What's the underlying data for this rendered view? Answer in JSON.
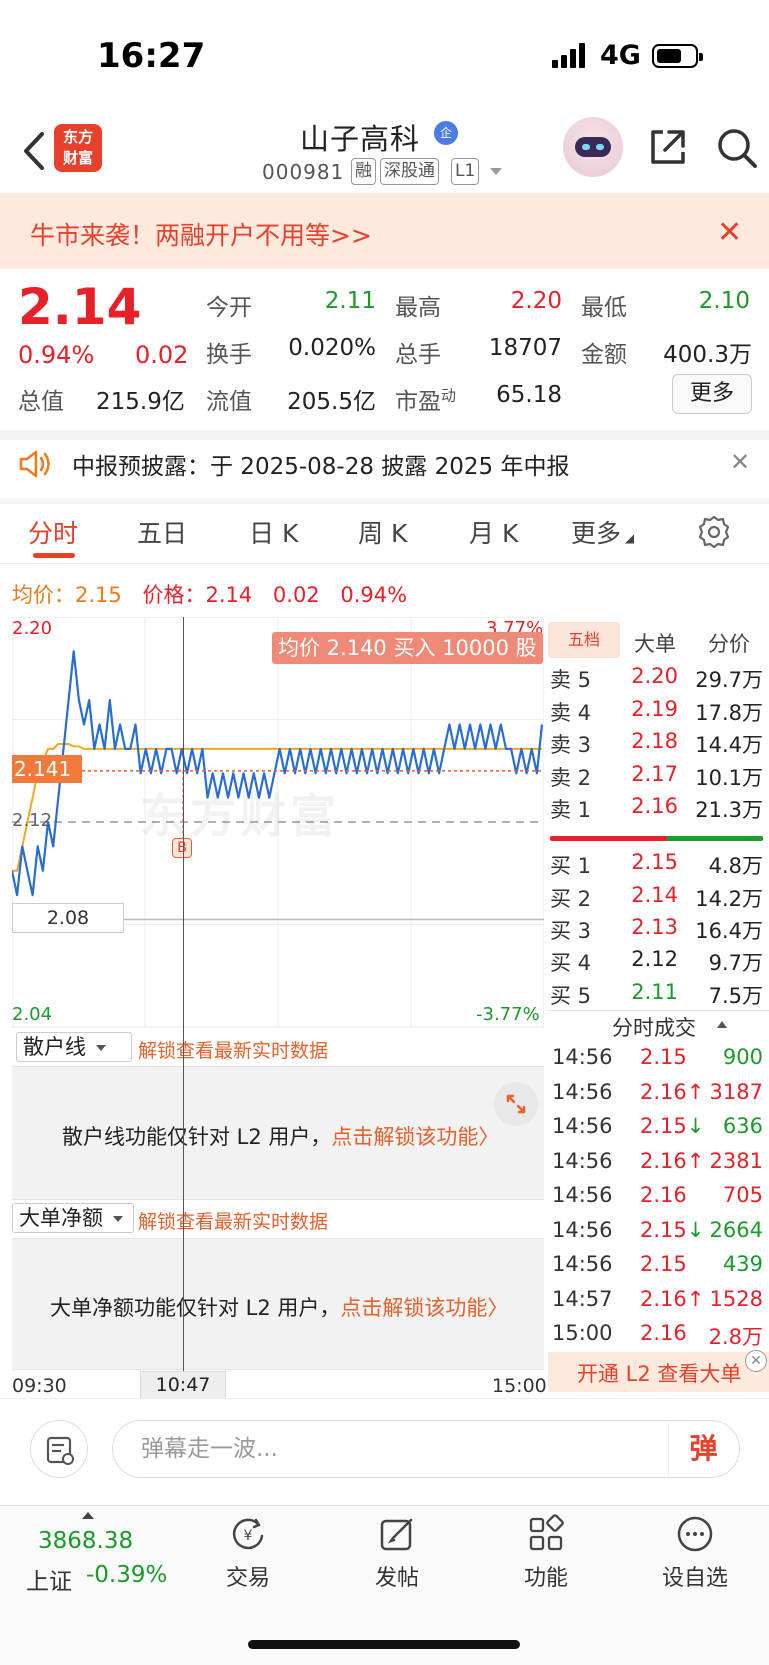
{
  "status_bar": {
    "time": "16:27",
    "network": "4G"
  },
  "header": {
    "logo_text": "东方财富",
    "stock_name": "山子高科",
    "verified_badge": "企",
    "stock_code": "000981",
    "tags": [
      "融",
      "深股通",
      "L1"
    ]
  },
  "promo": {
    "text": "牛市来袭！两融开户不用等>>"
  },
  "quote": {
    "price": "2.14",
    "change_pct": "0.94%",
    "change_amt": "0.02",
    "open_label": "今开",
    "open_value": "2.11",
    "high_label": "最高",
    "high_value": "2.20",
    "low_label": "最低",
    "low_value": "2.10",
    "turnover_label": "换手",
    "turnover_value": "0.020%",
    "volume_label": "总手",
    "volume_value": "18707",
    "amount_label": "金额",
    "amount_value": "400.3万",
    "cap_total_label": "总值",
    "cap_total_value": "215.9亿",
    "cap_float_label": "流值",
    "cap_float_value": "205.5亿",
    "pe_label": "市盈",
    "pe_sup": "动",
    "pe_value": "65.18",
    "more_label": "更多"
  },
  "notice": {
    "text": "中报预披露：于 2025-08-28 披露 2025 年中报"
  },
  "tabs": [
    "分时",
    "五日",
    "日 K",
    "周 K",
    "月 K",
    "更多"
  ],
  "price_line": {
    "avg_label": "均价：",
    "avg_value": "2.15",
    "price_label": "价格：",
    "price_value": "2.14",
    "change_amt": "0.02",
    "change_pct": "0.94%"
  },
  "chart": {
    "y_max": "2.20",
    "y_max_pct": "3.77%",
    "y_mid": "2.12",
    "y_min": "2.04",
    "y_min_pct": "-3.77%",
    "cursor_price": "2.141",
    "low_box": "2.08",
    "tooltip": "均价 2.140 买入 10000 股",
    "trade_marker": "B",
    "watermark": "东方财富",
    "time_start": "09:30",
    "cursor_time": "10:47",
    "time_end": "15:00"
  },
  "chart_data": {
    "type": "line",
    "title": "",
    "ylim": [
      2.04,
      2.2
    ],
    "reference_price": 2.12,
    "series": [
      {
        "values": [
          2.1,
          2.09,
          2.11,
          2.1,
          2.09,
          2.11,
          2.1,
          2.12,
          2.11,
          2.13,
          2.15,
          2.17,
          2.19,
          2.17,
          2.16,
          2.17,
          2.15,
          2.16,
          2.15,
          2.17,
          2.15,
          2.16,
          2.15,
          2.15,
          2.16,
          2.14,
          2.15,
          2.14,
          2.15,
          2.14,
          2.15,
          2.15,
          2.14,
          2.15,
          2.14,
          2.15,
          2.14,
          2.15,
          2.13,
          2.14,
          2.13,
          2.14,
          2.13,
          2.14,
          2.13,
          2.14,
          2.13,
          2.14,
          2.13,
          2.14,
          2.13,
          2.14,
          2.15,
          2.14,
          2.15,
          2.14,
          2.15,
          2.14,
          2.15,
          2.14,
          2.15,
          2.14,
          2.15,
          2.14,
          2.15,
          2.14,
          2.15,
          2.14,
          2.15,
          2.14,
          2.15,
          2.14,
          2.15,
          2.14,
          2.15,
          2.14,
          2.15,
          2.14,
          2.15,
          2.14,
          2.15,
          2.14,
          2.15,
          2.14,
          2.15,
          2.16,
          2.15,
          2.16,
          2.15,
          2.16,
          2.15,
          2.16,
          2.15,
          2.16,
          2.15,
          2.16,
          2.15,
          2.15,
          2.14,
          2.15,
          2.14,
          2.15,
          2.14,
          2.16
        ]
      },
      {
        "values": [
          2.1,
          2.1,
          2.11,
          2.12,
          2.13,
          2.14,
          2.145,
          2.15,
          2.15,
          2.152,
          2.152,
          2.152,
          2.151,
          2.151,
          2.15,
          2.15,
          2.15,
          2.15,
          2.15,
          2.15,
          2.15,
          2.15,
          2.15,
          2.15,
          2.15,
          2.15,
          2.15,
          2.15,
          2.15,
          2.15,
          2.15,
          2.15,
          2.15,
          2.15,
          2.15,
          2.15,
          2.15,
          2.15,
          2.15,
          2.15,
          2.15,
          2.15,
          2.15,
          2.15,
          2.15,
          2.15,
          2.15,
          2.15,
          2.15,
          2.15,
          2.15,
          2.15,
          2.15,
          2.15,
          2.15,
          2.15,
          2.15,
          2.15,
          2.15,
          2.15,
          2.15,
          2.15,
          2.15,
          2.15,
          2.15,
          2.15,
          2.15,
          2.15,
          2.15,
          2.15,
          2.15,
          2.15,
          2.15,
          2.15,
          2.15,
          2.15,
          2.15,
          2.15,
          2.15,
          2.15,
          2.15,
          2.15,
          2.15,
          2.15,
          2.15,
          2.15,
          2.15,
          2.15,
          2.15,
          2.15,
          2.15,
          2.15,
          2.15,
          2.15,
          2.15,
          2.15,
          2.15,
          2.15,
          2.15,
          2.15,
          2.15,
          2.15,
          2.15,
          2.15
        ]
      }
    ],
    "colors": {
      "price": "#2a6dd0",
      "average": "#f5a623"
    }
  },
  "subpanels": [
    {
      "select": "散户线",
      "unlock_link": "解锁查看最新实时数据",
      "locked_msg": "散户线功能仅针对 L2 用户，",
      "locked_link": "点击解锁该功能〉"
    },
    {
      "select": "大单净额",
      "unlock_link": "解锁查看最新实时数据",
      "locked_msg": "大单净额功能仅针对 L2 用户，",
      "locked_link": "点击解锁该功能〉"
    }
  ],
  "orderbook": {
    "tabs": [
      "五档",
      "大单",
      "分价"
    ],
    "asks": [
      {
        "label": "卖 5",
        "price": "2.20",
        "vol": "29.7万"
      },
      {
        "label": "卖 4",
        "price": "2.19",
        "vol": "17.8万"
      },
      {
        "label": "卖 3",
        "price": "2.18",
        "vol": "14.4万"
      },
      {
        "label": "卖 2",
        "price": "2.17",
        "vol": "10.1万"
      },
      {
        "label": "卖 1",
        "price": "2.16",
        "vol": "21.3万"
      }
    ],
    "bids": [
      {
        "label": "买 1",
        "price": "2.15",
        "vol": "4.8万"
      },
      {
        "label": "买 2",
        "price": "2.14",
        "vol": "14.2万"
      },
      {
        "label": "买 3",
        "price": "2.13",
        "vol": "16.4万"
      },
      {
        "label": "买 4",
        "price": "2.12",
        "vol": "9.7万"
      },
      {
        "label": "买 5",
        "price": "2.11",
        "vol": "7.5万"
      }
    ]
  },
  "ticks": {
    "header": "分时成交",
    "rows": [
      {
        "time": "14:56",
        "price": "2.15",
        "arrow": "",
        "vol": "900",
        "color": "red",
        "vcolor": "green"
      },
      {
        "time": "14:56",
        "price": "2.16",
        "arrow": "↑",
        "vol": "3187",
        "color": "red",
        "vcolor": "red"
      },
      {
        "time": "14:56",
        "price": "2.15",
        "arrow": "↓",
        "vol": "636",
        "color": "red",
        "vcolor": "green"
      },
      {
        "time": "14:56",
        "price": "2.16",
        "arrow": "↑",
        "vol": "2381",
        "color": "red",
        "vcolor": "red"
      },
      {
        "time": "14:56",
        "price": "2.16",
        "arrow": "",
        "vol": "705",
        "color": "red",
        "vcolor": "red"
      },
      {
        "time": "14:56",
        "price": "2.15",
        "arrow": "↓",
        "vol": "2664",
        "color": "red",
        "vcolor": "green"
      },
      {
        "time": "14:56",
        "price": "2.15",
        "arrow": "",
        "vol": "439",
        "color": "red",
        "vcolor": "green"
      },
      {
        "time": "14:57",
        "price": "2.16",
        "arrow": "↑",
        "vol": "1528",
        "color": "red",
        "vcolor": "red"
      },
      {
        "time": "15:00",
        "price": "2.16",
        "arrow": "",
        "vol": "2.8万",
        "color": "red",
        "vcolor": "red"
      }
    ],
    "l2_banner": "开通 L2 查看大单"
  },
  "comment": {
    "placeholder": "弹幕走一波...",
    "danmu": "弹"
  },
  "bottom_nav": {
    "index_value": "3868.38",
    "index_name": "上证",
    "index_change": "-0.39%",
    "items": [
      "交易",
      "发帖",
      "功能",
      "设自选"
    ]
  }
}
